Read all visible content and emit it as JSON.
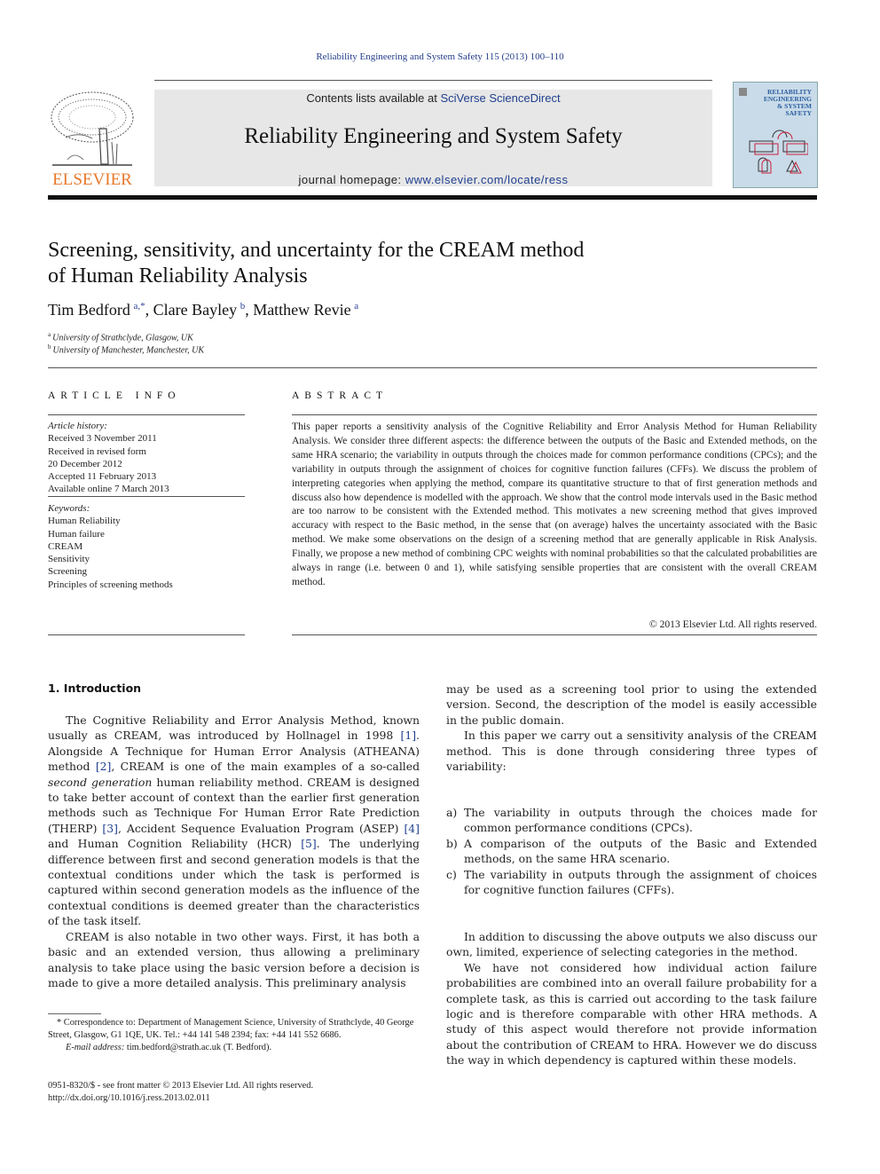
{
  "header": {
    "journal_reference": "Reliability Engineering and System Safety 115 (2013) 100–110",
    "contents_prefix": "Contents lists available at ",
    "contents_link": "SciVerse ScienceDirect",
    "journal_title": "Reliability Engineering and System Safety",
    "homepage_prefix": "journal homepage: ",
    "homepage_link": "www.elsevier.com/locate/ress",
    "publisher_logo_text": "ELSEVIER",
    "cover_title_lines": [
      "RELIABILITY",
      "ENGINEERING",
      "& SYSTEM",
      "SAFETY"
    ],
    "colors": {
      "link": "#1f3f8f",
      "publisher_orange": "#e8782a",
      "banner_bg": "#e7e7e7"
    }
  },
  "article": {
    "title_line1": "Screening, sensitivity, and uncertainty for the CREAM method",
    "title_line2": "of Human Reliability Analysis",
    "authors": [
      {
        "name": "Tim Bedford",
        "sup": "a,*"
      },
      {
        "name": "Clare Bayley",
        "sup": "b"
      },
      {
        "name": "Matthew Revie",
        "sup": "a"
      }
    ],
    "affiliations": [
      {
        "mark": "a",
        "text": "University of Strathclyde, Glasgow, UK"
      },
      {
        "mark": "b",
        "text": "University of Manchester, Manchester, UK"
      }
    ]
  },
  "article_info": {
    "heading": "ARTICLE INFO",
    "history_label": "Article history:",
    "history": [
      "Received 3 November 2011",
      "Received in revised form",
      "20 December 2012",
      "Accepted 11 February 2013",
      "Available online 7 March 2013"
    ],
    "keywords_label": "Keywords:",
    "keywords": [
      "Human Reliability",
      "Human failure",
      "CREAM",
      "Sensitivity",
      "Screening",
      "Principles of screening methods"
    ]
  },
  "abstract": {
    "heading": "ABSTRACT",
    "text": "This paper reports a sensitivity analysis of the Cognitive Reliability and Error Analysis Method for Human Reliability Analysis. We consider three different aspects: the difference between the outputs of the Basic and Extended methods, on the same HRA scenario; the variability in outputs through the choices made for common performance conditions (CPCs); and the variability in outputs through the assignment of choices for cognitive function failures (CFFs). We discuss the problem of interpreting categories when applying the method, compare its quantitative structure to that of first generation methods and discuss also how dependence is modelled with the approach. We show that the control mode intervals used in the Basic method are too narrow to be consistent with the Extended method. This motivates a new screening method that gives improved accuracy with respect to the Basic method, in the sense that (on average) halves the uncertainty associated with the Basic method. We make some observations on the design of a screening method that are generally applicable in Risk Analysis. Finally, we propose a new method of combining CPC weights with nominal probabilities so that the calculated probabilities are always in range (i.e. between 0 and 1), while satisfying sensible properties that are consistent with the overall CREAM method.",
    "copyright": "© 2013 Elsevier Ltd. All rights reserved."
  },
  "body": {
    "section_heading": "1.  Introduction",
    "left": {
      "p1_parts": [
        "The Cognitive Reliability and Error Analysis Method, known usually as CREAM, was introduced by Hollnagel in 1998 ",
        "[1]",
        ". Alongside A Technique for Human Error Analysis (ATHEANA) method ",
        "[2]",
        ", CREAM is one of the main examples of a so-called ",
        "second generation",
        " human reliability method. CREAM is designed to take better account of context than the earlier first generation methods such as Technique For Human Error Rate Prediction (THERP) ",
        "[3]",
        ", Accident Sequence Evaluation Program (ASEP) ",
        "[4]",
        " and Human Cognition Reliability (HCR) ",
        "[5]",
        ". The underlying difference between first and second generation models is that the contextual conditions under which the task is performed is captured within second generation models as the influence of the contextual conditions is deemed greater than the characteristics of the task itself."
      ],
      "p2": "CREAM is also notable in two other ways. First, it has both a basic and an extended version, thus allowing a preliminary analysis to take place using the basic version before a decision is made to give a more detailed analysis. This preliminary analysis"
    },
    "right": {
      "p1": "may be used as a screening tool prior to using the extended version. Second, the description of the model is easily accessible in the public domain.",
      "p2": "In this paper we carry out a sensitivity analysis of the CREAM method. This is done through considering three types of variability:",
      "list": [
        {
          "label": "a)",
          "text": "The variability in outputs through the choices made for common performance conditions (CPCs)."
        },
        {
          "label": "b)",
          "text": "A comparison of the outputs of the Basic and Extended methods, on the same HRA scenario."
        },
        {
          "label": "c)",
          "text": "The variability in outputs through the assignment of choices for cognitive function failures (CFFs)."
        }
      ],
      "p3": "In addition to discussing the above outputs we also discuss our own, limited, experience of selecting categories in the method.",
      "p4": "We have not considered how individual action failure probabilities are combined into an overall failure probability for a complete task, as this is carried out according to the task failure logic and is therefore comparable with other HRA methods. A study of this aspect would therefore not provide information about the contribution of CREAM to HRA. However we do discuss the way in which dependency is captured within these models."
    }
  },
  "footnotes": {
    "correspondence": "* Correspondence to: Department of Management Science, University of Strathclyde, 40 George Street, Glasgow, G1 1QE, UK. Tel.: +44 141 548 2394; fax: +44 141 552 6686.",
    "email_label": "E-mail address:",
    "email": " tim.bedford@strath.ac.uk (T. Bedford).",
    "issn": "0951-8320/$ - see front matter © 2013 Elsevier Ltd. All rights reserved.",
    "doi": "http://dx.doi.org/10.1016/j.ress.2013.02.011"
  }
}
